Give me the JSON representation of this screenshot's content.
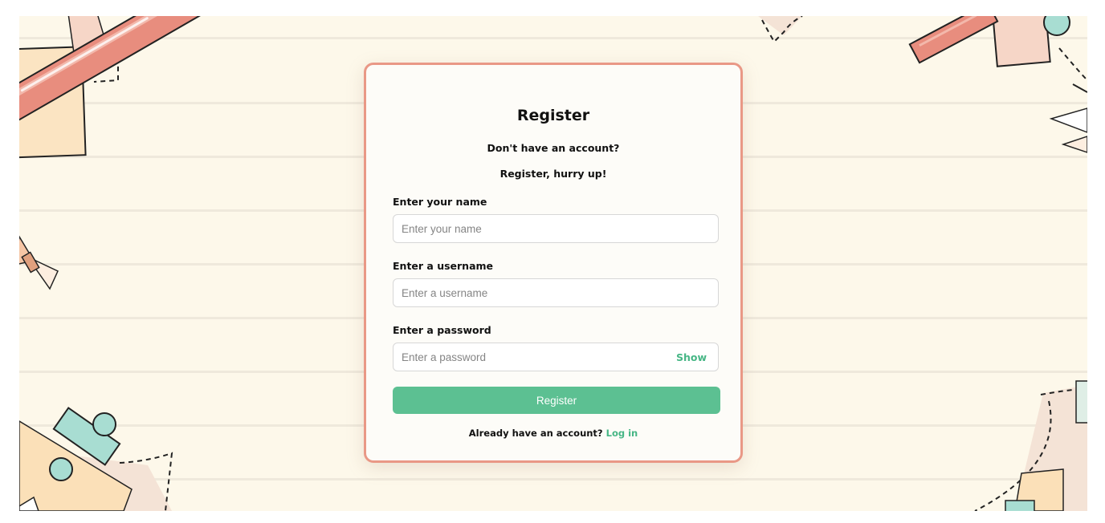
{
  "form": {
    "title": "Register",
    "subtitle": "Don't have an account?",
    "tagline": "Register, hurry up!",
    "name": {
      "label": "Enter your name",
      "placeholder": "Enter your name",
      "value": ""
    },
    "username": {
      "label": "Enter a username",
      "placeholder": "Enter a username",
      "value": ""
    },
    "password": {
      "label": "Enter a password",
      "placeholder": "Enter a password",
      "value": "",
      "toggle_label": "Show"
    },
    "submit_label": "Register",
    "footer": {
      "text": "Already have an account?",
      "link": "Log in"
    }
  },
  "theme": {
    "background": "#fdf8ea",
    "card_border": "#e99886",
    "accent": "#5cc092",
    "link": "#46b685"
  },
  "icons": [
    "pencil-decoration",
    "paper-sheet-decoration",
    "paper-plane-decoration",
    "shapes-decoration"
  ]
}
